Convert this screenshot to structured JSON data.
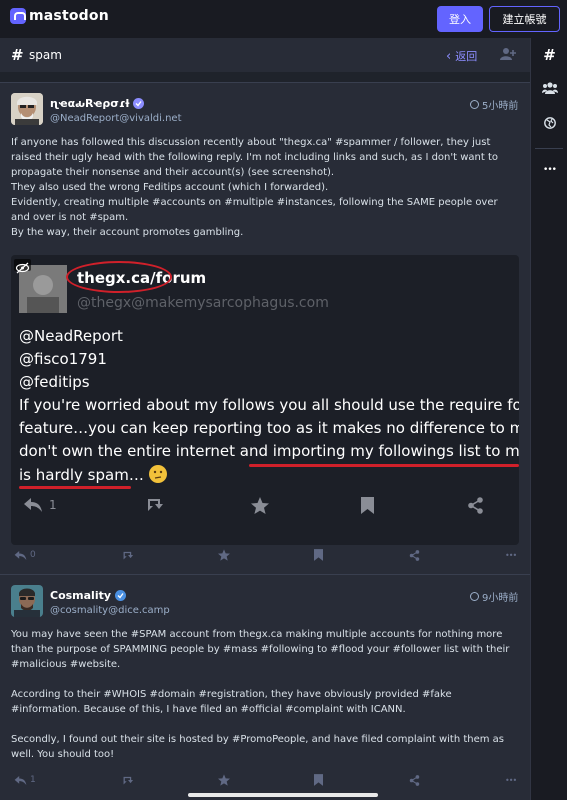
{
  "app": {
    "logo_text": "mastodon"
  },
  "topbar": {
    "login_label": "登入",
    "register_label": "建立帳號"
  },
  "column": {
    "hash_symbol": "#",
    "title": "spam",
    "back_label": "返回"
  },
  "sidebar": {
    "items": [
      "hashtag-icon",
      "people-icon",
      "globe-icon",
      "more-icon"
    ],
    "more_label": "•••"
  },
  "posts": [
    {
      "display_name": "ɳҽαԃRҽρσɾƚ",
      "acct": "@NeadReport@vivaldi.net",
      "time": "5小時前",
      "paragraphs": [
        "If anyone has followed this discussion recently about \"thegx.ca\" #spammer / follower, they just raised their ugly head with the following reply. I'm not including links and such, as I don't want to propagate their nonsense and their account(s) (see screenshot).",
        "They also used the wrong Feditips account (which I forwarded).",
        "Evidently, creating multiple #accounts on #multiple #instances, following the SAME people over and over is not #spam.",
        "By the way, their account promotes gambling."
      ],
      "media": {
        "name": "thegx.ca/forum",
        "handle": "@thegx@makemysarcophagus.com",
        "mentions": [
          "@NeadReport",
          "@fisco1791",
          "@feditips"
        ],
        "line1": "If you're worried about my follows you all should use the require follow r",
        "line2": "feature…you can keep reporting too as it makes no difference to me as y",
        "line3_a": "don't own the entire internet and ",
        "line3_b": "importing my followings list to my new",
        "line4": "is hardly spam…",
        "reply_count": "1"
      },
      "reply_count": "0"
    },
    {
      "display_name": "Cosmality",
      "acct": "@cosmality@dice.camp",
      "time": "9小時前",
      "paragraphs": [
        "You may have seen the #SPAM account from thegx.ca making multiple accounts for nothing more than the purpose of SPAMMING people by #mass #following to #flood your #follower list with their #malicious #website.",
        "According to their #WHOIS #domain #registration, they have obviously provided #fake #information. Because of this, I have filed an #official #complaint with ICANN.",
        "Secondly, I found out their site is hosted by #PromoPeople, and have filed complaint with them as well. You should too!"
      ],
      "reply_count": "1"
    }
  ],
  "colors": {
    "accent": "#6364ff",
    "link": "#8c8dff",
    "bg": "#191b22",
    "column": "#282c37",
    "muted": "#9baec8",
    "annotation": "#d0202a"
  }
}
